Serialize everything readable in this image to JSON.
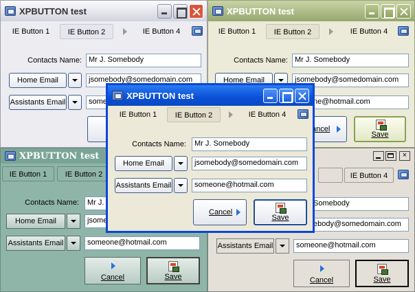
{
  "title": "XPBUTTON test",
  "toolbar": {
    "ie1": "IE Button 1",
    "ie2": "IE Button 2",
    "ie4": "IE Button 4"
  },
  "form": {
    "contacts_label": "Contacts Name:",
    "contacts_value": "Mr J. Somebody",
    "contacts_value_cut": "Mr J.",
    "contacts_value_tail": "Somebody",
    "home_email_label": "Home Email",
    "home_email_value": "jsomebody@somedomain.com",
    "home_email_value_cut": "jsomeb",
    "home_email_value_tail": "ebody@somedomain.com",
    "assistants_email_label": "Assistants Email",
    "assistants_email_value": "someone@hotmail.com",
    "assistants_email_value_cut": "some",
    "assistants_email_value_tail": "ne@hotmail.com"
  },
  "buttons": {
    "cancel": "Cancel",
    "save": "Save"
  },
  "colors": {
    "xp_blue": "#0a47d8",
    "olive": "#96a86f",
    "silver": "#d3d3df",
    "teal": "#8fb5a8",
    "classic": "#e4e0d8"
  }
}
